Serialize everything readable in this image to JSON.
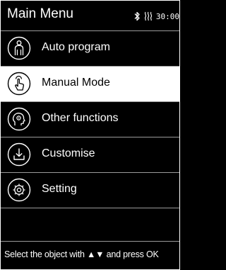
{
  "header": {
    "title": "Main Menu",
    "bluetooth_icon": "bluetooth-icon",
    "heat_icon": "heat-waves-icon",
    "timer": "30:00"
  },
  "menu": {
    "items": [
      {
        "label": "Auto program",
        "icon": "body-figure-icon",
        "selected": false
      },
      {
        "label": "Manual Mode",
        "icon": "finger-tap-icon",
        "selected": true
      },
      {
        "label": "Other functions",
        "icon": "head-gear-icon",
        "selected": false
      },
      {
        "label": "Customise",
        "icon": "download-tray-icon",
        "selected": false
      },
      {
        "label": "Setting",
        "icon": "gear-icon",
        "selected": false
      }
    ]
  },
  "footer": {
    "hint": "Select the object with ▲▼ and press OK"
  },
  "colors": {
    "background": "#000000",
    "text": "#ffffff",
    "selected_background": "#ffffff",
    "selected_text": "#000000",
    "divider": "#9a9a9a"
  }
}
